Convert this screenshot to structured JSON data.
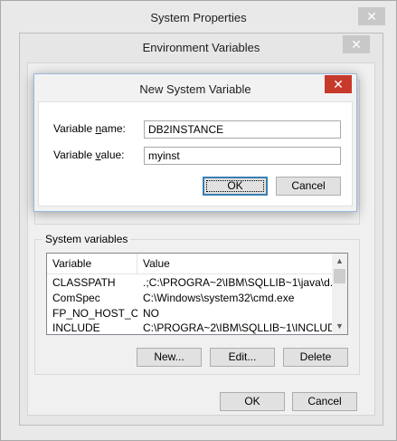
{
  "system_properties": {
    "title": "System Properties",
    "close_glyph": "✕"
  },
  "environment_variables": {
    "title": "Environment Variables",
    "close_glyph": "✕",
    "system_variables": {
      "group_label": "System variables",
      "columns": [
        "Variable",
        "Value"
      ],
      "rows": [
        {
          "variable": "CLASSPATH",
          "value": ".;C:\\PROGRA~2\\IBM\\SQLLIB~1\\java\\d..."
        },
        {
          "variable": "ComSpec",
          "value": "C:\\Windows\\system32\\cmd.exe"
        },
        {
          "variable": "FP_NO_HOST_C...",
          "value": "NO"
        },
        {
          "variable": "INCLUDE",
          "value": "C:\\PROGRA~2\\IBM\\SQLLIB~1\\INCLUDE..."
        }
      ],
      "buttons": {
        "new": "New...",
        "edit": "Edit...",
        "delete": "Delete"
      }
    },
    "ok_label": "OK",
    "cancel_label": "Cancel"
  },
  "new_system_variable": {
    "title": "New System Variable",
    "close_glyph": "✕",
    "name_label_pre": "Variable ",
    "name_label_mnemonic": "n",
    "name_label_post": "ame:",
    "value_label_pre": "Variable ",
    "value_label_mnemonic": "v",
    "value_label_post": "alue:",
    "name_value": "DB2INSTANCE",
    "value_value": "myinst",
    "ok_label": "OK",
    "cancel_label": "Cancel"
  },
  "colors": {
    "close_active": "#c7392b",
    "close_inactive": "#c8c8c8",
    "default_button_border": "#3c7fb1"
  },
  "icons": {
    "close": "close-icon",
    "scroll_up": "scroll-up-arrow-icon",
    "scroll_down": "scroll-down-arrow-icon"
  }
}
